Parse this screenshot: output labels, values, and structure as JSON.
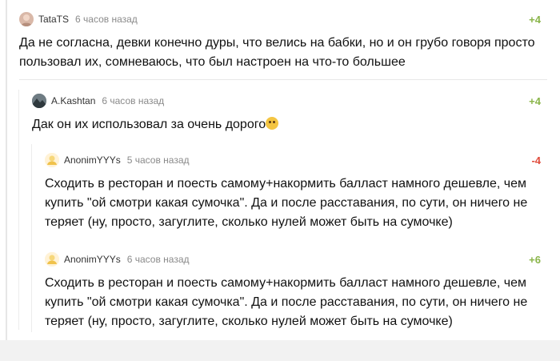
{
  "comments": [
    {
      "author": "TataTS",
      "time": "6 часов назад",
      "rating": "+4",
      "text": "Да не согласна, девки конечно дуры, что велись на бабки, но и он грубо говоря просто пользовал их, сомневаюсь, что был настроен на что-то большее",
      "avatar_icon": "user-avatar-photo"
    },
    {
      "author": "A.Kashtan",
      "time": "6 часов назад",
      "rating": "+4",
      "text": "Дак он их использовал за очень дорого",
      "emoji_icon": "thinking-face-emoji",
      "avatar_icon": "user-avatar-photo"
    },
    {
      "author": "AnonimYYYs",
      "time": "5 часов назад",
      "rating": "-4",
      "text": "Сходить в ресторан и поесть самому+накормить балласт намного дешевле, чем купить \"ой смотри какая сумочка\". Да и после расставания, по сути, он ничего не теряет (ну, просто, загуглите, сколько нулей может быть на сумочке)",
      "avatar_icon": "anonymous-avatar"
    },
    {
      "author": "AnonimYYYs",
      "time": "6 часов назад",
      "rating": "+6",
      "text": "Сходить в ресторан и поесть самому+накормить балласт намного дешевле, чем купить \"ой смотри какая сумочка\". Да и после расставания, по сути, он ничего не теряет (ну, просто, загуглите, сколько нулей может быть на сумочке)",
      "avatar_icon": "anonymous-avatar"
    }
  ],
  "colors": {
    "positive_rating": "#8ab54a",
    "negative_rating": "#e04b3b",
    "meta_text": "#8a8a8a"
  }
}
